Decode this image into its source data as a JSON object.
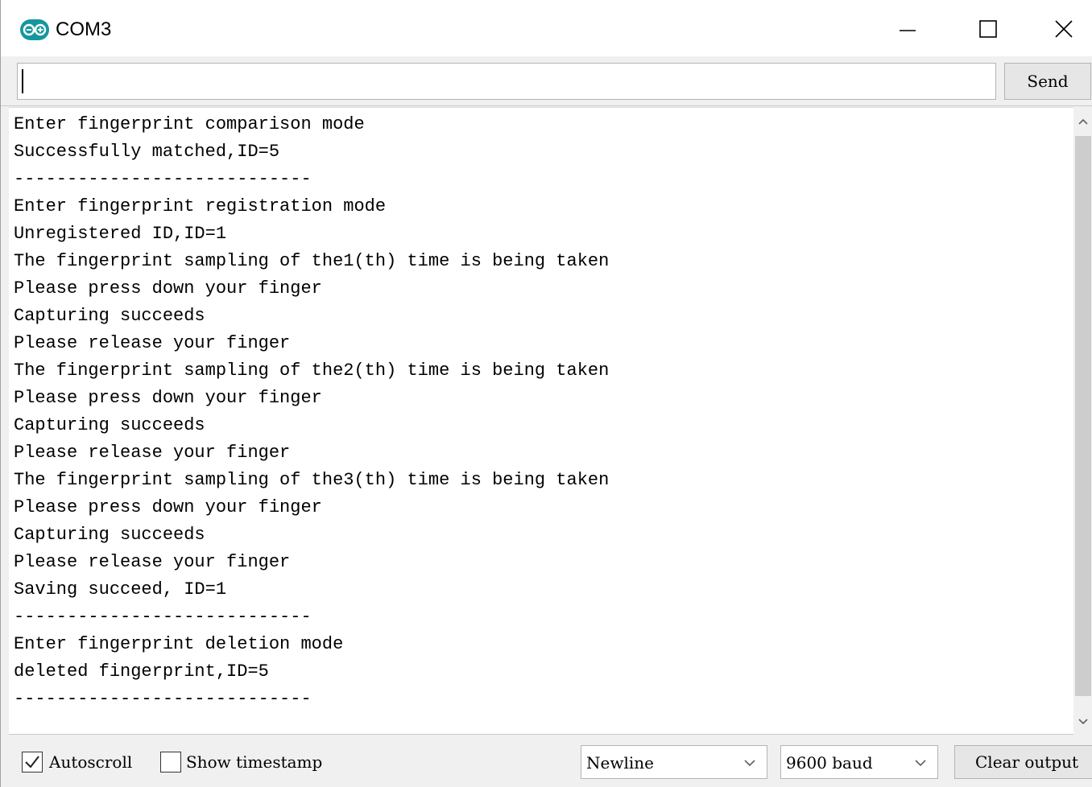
{
  "window": {
    "title": "COM3",
    "icon": "arduino-logo-icon",
    "controls": [
      "minimize-icon",
      "maximize-icon",
      "close-icon"
    ]
  },
  "input": {
    "value": "",
    "send_label": "Send"
  },
  "output_lines": [
    "Enter fingerprint comparison mode",
    "Successfully matched,ID=5",
    "----------------------------",
    "Enter fingerprint registration mode",
    "Unregistered ID,ID=1",
    "The fingerprint sampling of the1(th) time is being taken",
    "Please press down your finger",
    "Capturing succeeds",
    "Please release your finger",
    "The fingerprint sampling of the2(th) time is being taken",
    "Please press down your finger",
    "Capturing succeeds",
    "Please release your finger",
    "The fingerprint sampling of the3(th) time is being taken",
    "Please press down your finger",
    "Capturing succeeds",
    "Please release your finger",
    "Saving succeed, ID=1",
    "----------------------------",
    "Enter fingerprint deletion mode",
    "deleted fingerprint,ID=5",
    "----------------------------"
  ],
  "footer": {
    "autoscroll_label": "Autoscroll",
    "autoscroll_checked": true,
    "timestamp_label": "Show timestamp",
    "timestamp_checked": false,
    "line_ending": "Newline",
    "baud_rate": "9600 baud",
    "clear_label": "Clear output"
  },
  "colors": {
    "icon_teal": "#14979c",
    "chrome": "#f0f0f0"
  }
}
